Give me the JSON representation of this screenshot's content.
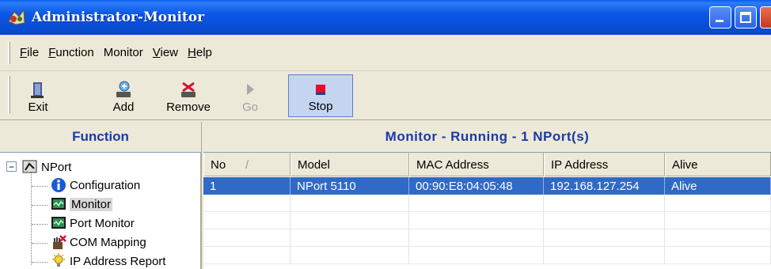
{
  "window": {
    "title": "Administrator-Monitor"
  },
  "menu": {
    "items": [
      {
        "label": "File",
        "underline": "F"
      },
      {
        "label": "Function",
        "underline": "F"
      },
      {
        "label": "Monitor",
        "underline": "M"
      },
      {
        "label": "View",
        "underline": "V"
      },
      {
        "label": "Help",
        "underline": "H"
      }
    ]
  },
  "toolbar": {
    "exit_label": "Exit",
    "add_label": "Add",
    "remove_label": "Remove",
    "go_label": "Go",
    "stop_label": "Stop"
  },
  "left_panel": {
    "header": "Function",
    "tree": {
      "root": "NPort",
      "children": [
        {
          "label": "Configuration",
          "icon": "info-icon"
        },
        {
          "label": "Monitor",
          "icon": "monitor-icon",
          "selected": true
        },
        {
          "label": "Port Monitor",
          "icon": "port-monitor-icon"
        },
        {
          "label": "COM Mapping",
          "icon": "com-mapping-icon"
        },
        {
          "label": "IP Address Report",
          "icon": "ip-report-icon"
        }
      ]
    }
  },
  "right_panel": {
    "header": "Monitor - Running - 1 NPort(s)",
    "columns": [
      "No",
      "Model",
      "MAC Address",
      "IP Address",
      "Alive"
    ],
    "sort_indicator": "/",
    "rows": [
      [
        "1",
        "NPort 5110",
        "00:90:E8:04:05:48",
        "192.168.127.254",
        "Alive"
      ]
    ]
  },
  "colors": {
    "title_bar": "#0b58e6",
    "panel_header_text": "#1a3aa6",
    "selection": "#3169c6",
    "stop_icon": "#e0102a"
  }
}
